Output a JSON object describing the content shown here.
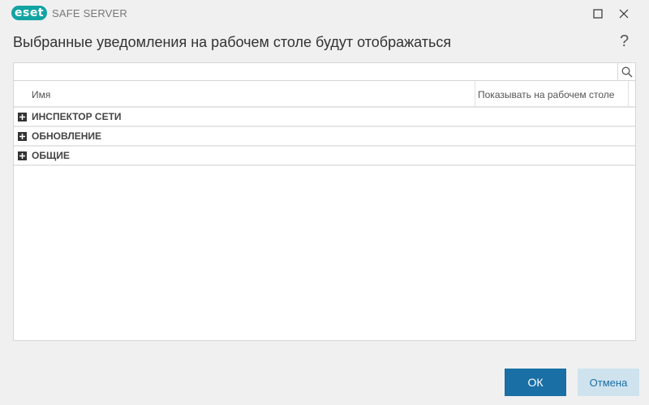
{
  "window": {
    "brand": "eset",
    "product": "SAFE SERVER",
    "brand_color": "#13a3a3"
  },
  "dialog": {
    "title": "Выбранные уведомления на рабочем столе будут отображаться",
    "help_label": "?"
  },
  "search": {
    "value": "",
    "placeholder": ""
  },
  "table": {
    "columns": [
      "Имя",
      "Показывать на рабочем столе"
    ],
    "groups": [
      {
        "label": "ИНСПЕКТОР СЕТИ"
      },
      {
        "label": "ОБНОВЛЕНИЕ"
      },
      {
        "label": "ОБЩИЕ"
      }
    ]
  },
  "buttons": {
    "ok": "ОК",
    "cancel": "Отмена",
    "accent_color": "#1a6fa5"
  },
  "icons": {
    "maximize": "maximize-icon",
    "close": "close-icon",
    "search": "search-icon",
    "expand": "plus-expand-icon"
  }
}
